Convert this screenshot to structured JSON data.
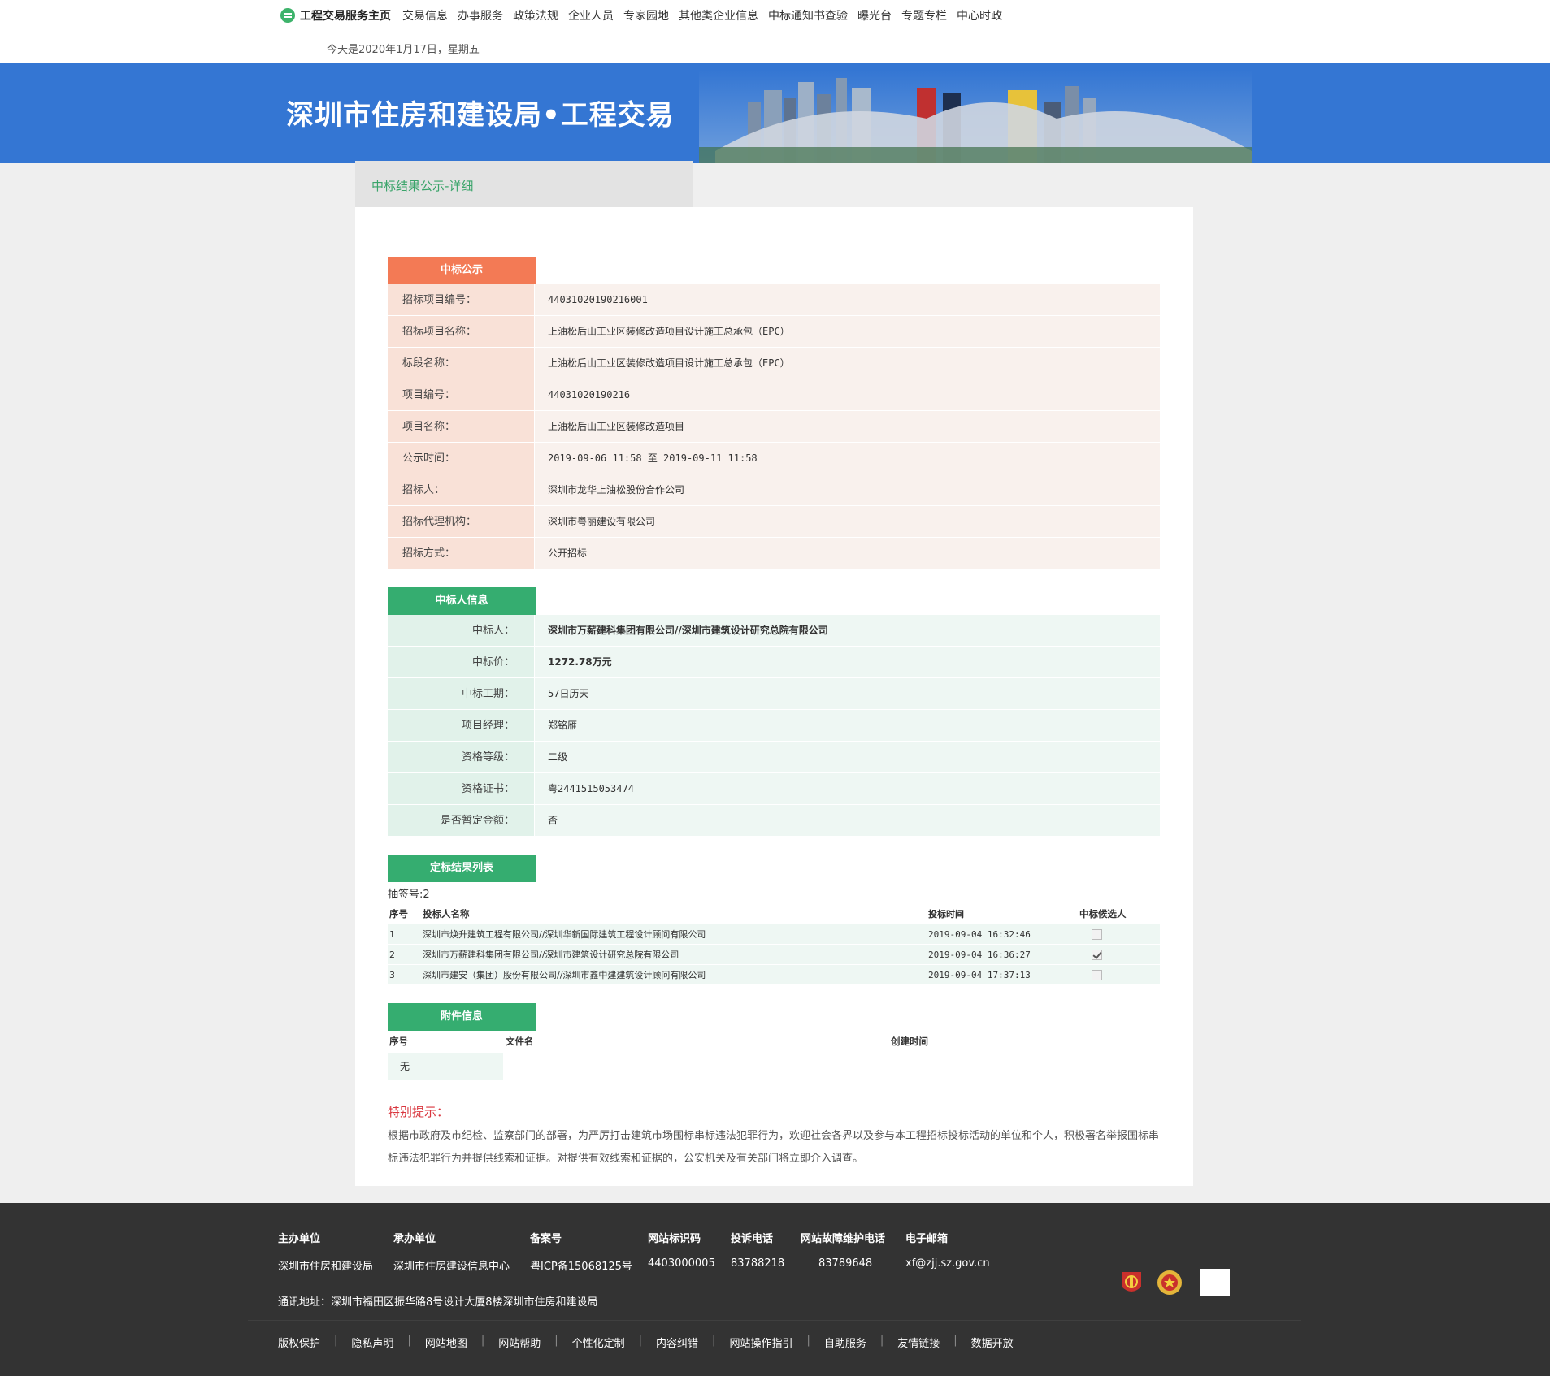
{
  "nav": {
    "home": "工程交易服务主页",
    "items": [
      "交易信息",
      "办事服务",
      "政策法规",
      "企业人员",
      "专家园地",
      "其他类企业信息",
      "中标通知书查验",
      "曝光台",
      "专题专栏",
      "中心时政"
    ]
  },
  "date_text": "今天是2020年1月17日，星期五",
  "banner": {
    "title": "深圳市住房和建设局•工程交易"
  },
  "tab": {
    "label": "中标结果公示-详细"
  },
  "section1": {
    "title": "中标公示",
    "rows": [
      {
        "k": "招标项目编号：",
        "v": "44031020190216001"
      },
      {
        "k": "招标项目名称：",
        "v": "上油松后山工业区装修改造项目设计施工总承包（EPC）"
      },
      {
        "k": "标段名称：",
        "v": "上油松后山工业区装修改造项目设计施工总承包（EPC）"
      },
      {
        "k": "项目编号：",
        "v": "44031020190216"
      },
      {
        "k": "项目名称：",
        "v": "上油松后山工业区装修改造项目"
      },
      {
        "k": "公示时间：",
        "v": "2019-09-06 11:58 至 2019-09-11 11:58"
      },
      {
        "k": "招标人：",
        "v": "深圳市龙华上油松股份合作公司"
      },
      {
        "k": "招标代理机构：",
        "v": "深圳市粤丽建设有限公司"
      },
      {
        "k": "招标方式：",
        "v": "公开招标"
      }
    ]
  },
  "section2": {
    "title": "中标人信息",
    "rows": [
      {
        "k": "中标人：",
        "v": "深圳市万薪建科集团有限公司//深圳市建筑设计研究总院有限公司"
      },
      {
        "k": "中标价：",
        "v": "1272.78万元"
      },
      {
        "k": "中标工期：",
        "v": "57日历天"
      },
      {
        "k": "项目经理：",
        "v": "郑铭雁"
      },
      {
        "k": "资格等级：",
        "v": "二级"
      },
      {
        "k": "资格证书：",
        "v": "粤2441515053474"
      },
      {
        "k": "是否暂定金额：",
        "v": "否"
      }
    ]
  },
  "section3": {
    "title": "定标结果列表",
    "draw": "抽签号:2",
    "headers": [
      "序号",
      "投标人名称",
      "投标时间",
      "中标候选人"
    ],
    "rows": [
      {
        "no": "1",
        "name": "深圳市焕升建筑工程有限公司//深圳华新国际建筑工程设计顾问有限公司",
        "time": "2019-09-04 16:32:46",
        "checked": false
      },
      {
        "no": "2",
        "name": "深圳市万薪建科集团有限公司//深圳市建筑设计研究总院有限公司",
        "time": "2019-09-04 16:36:27",
        "checked": true
      },
      {
        "no": "3",
        "name": "深圳市建安（集团）股份有限公司//深圳市鑫中建建筑设计顾问有限公司",
        "time": "2019-09-04 17:37:13",
        "checked": false
      }
    ]
  },
  "section4": {
    "title": "附件信息",
    "headers": [
      "序号",
      "文件名",
      "创建时间"
    ],
    "empty": "无"
  },
  "notice": {
    "title": "特别提示：",
    "text": "根据市政府及市纪检、监察部门的部署，为严厉打击建筑市场围标串标违法犯罪行为，欢迎社会各界以及参与本工程招标投标活动的单位和个人，积极署名举报围标串标违法犯罪行为并提供线索和证据。对提供有效线索和证据的，公安机关及有关部门将立即介入调查。"
  },
  "footer": {
    "cols": [
      {
        "h": "主办单位",
        "v": "深圳市住房和建设局"
      },
      {
        "h": "承办单位",
        "v": "深圳市住房建设信息中心"
      },
      {
        "h": "备案号",
        "v": "粤ICP备15068125号"
      },
      {
        "h": "网站标识码",
        "v": "4403000005"
      },
      {
        "h": "投诉电话",
        "v": "83788218"
      },
      {
        "h": "网站故障维护电话",
        "v": "83789648"
      },
      {
        "h": "电子邮箱",
        "v": "xf@zjj.sz.gov.cn"
      }
    ],
    "address": "通讯地址：深圳市福田区振华路8号设计大厦8楼深圳市住房和建设局",
    "links": [
      "版权保护",
      "隐私声明",
      "网站地图",
      "网站帮助",
      "个性化定制",
      "内容纠错",
      "网站操作指引",
      "自助服务",
      "友情链接",
      "数据开放"
    ]
  },
  "colors": {
    "banner": "#3476d3",
    "accent_green": "#35ad70",
    "accent_orange": "#f37a55",
    "notice_red": "#d9363e",
    "footer": "#333333"
  }
}
